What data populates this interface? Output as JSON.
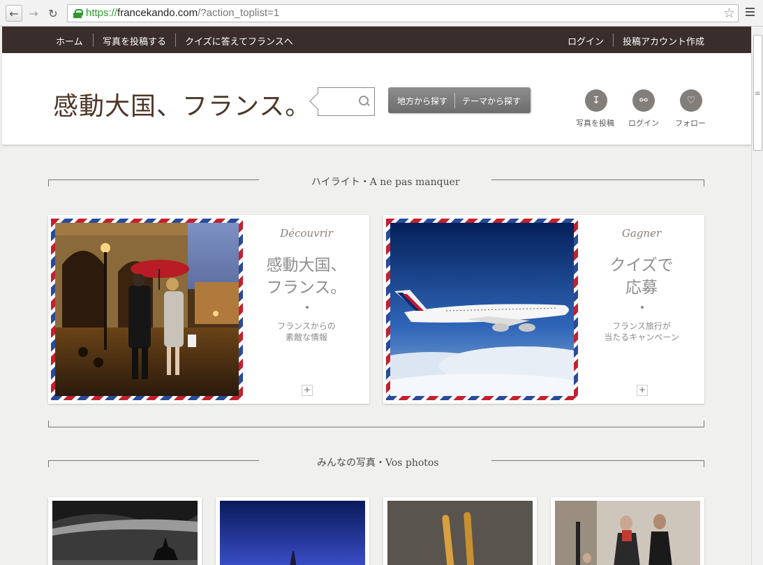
{
  "browser": {
    "url_scheme": "https://",
    "url_host": "francekando.com",
    "url_path": "/?action_toplist=1"
  },
  "topnav": {
    "left": [
      "ホーム",
      "写真を投稿する",
      "クイズに答えてフランスへ"
    ],
    "right": [
      "ログイン",
      "投稿アカウント作成"
    ]
  },
  "header": {
    "logo": "感動大国、フランス。",
    "search_placeholder": "",
    "pills": [
      "地方から探す",
      "テーマから探す"
    ],
    "actions": [
      {
        "label": "写真を投稿",
        "icon": "upload-icon"
      },
      {
        "label": "ログイン",
        "icon": "user-icon"
      },
      {
        "label": "フォロー",
        "icon": "heart-icon"
      }
    ]
  },
  "highlight_section": {
    "title": "ハイライト・A ne pas manquer",
    "cards": [
      {
        "script": "Découvrir",
        "title": [
          "感動大国、",
          "フランス。"
        ],
        "desc": [
          "フランスからの",
          "素敵な情報"
        ],
        "plus": "+"
      },
      {
        "script": "Gagner",
        "title": [
          "クイズで",
          "応募"
        ],
        "desc": [
          "フランス旅行が",
          "当たるキャンペーン"
        ],
        "plus": "+"
      }
    ]
  },
  "photos_section": {
    "title": "みんなの写真・Vos photos"
  },
  "colors": {
    "nav_bg": "#3a2e2c",
    "logo": "#4e3627",
    "airmail_red": "#c42030",
    "airmail_blue": "#2a4a9a"
  }
}
